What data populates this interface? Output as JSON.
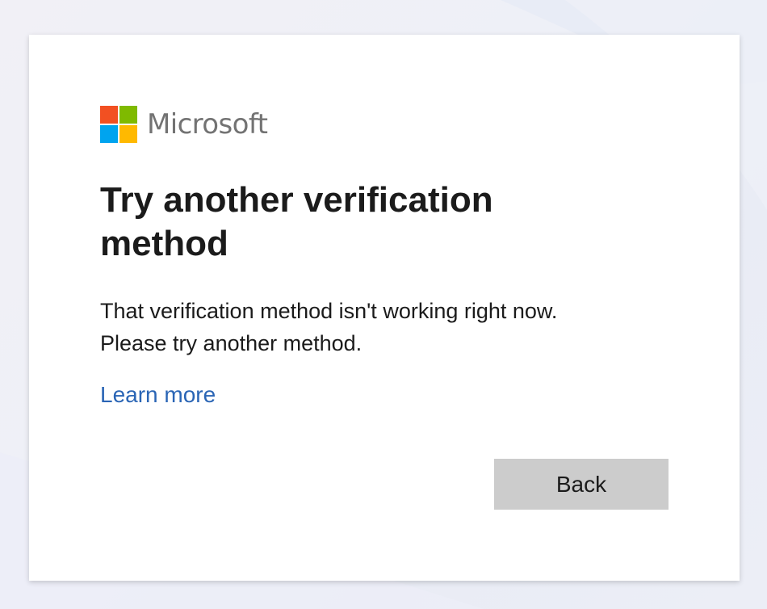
{
  "brand": {
    "name": "Microsoft",
    "logo_colors": [
      "#f25022",
      "#7fba00",
      "#00a4ef",
      "#ffb900"
    ]
  },
  "dialog": {
    "title": "Try another verification method",
    "message_line1": "That verification method isn't working right now.",
    "message_line2": "Please try another method.",
    "learn_more": "Learn more",
    "back_label": "Back"
  },
  "colors": {
    "link": "#2a65b5",
    "button_bg": "#cccccc"
  }
}
